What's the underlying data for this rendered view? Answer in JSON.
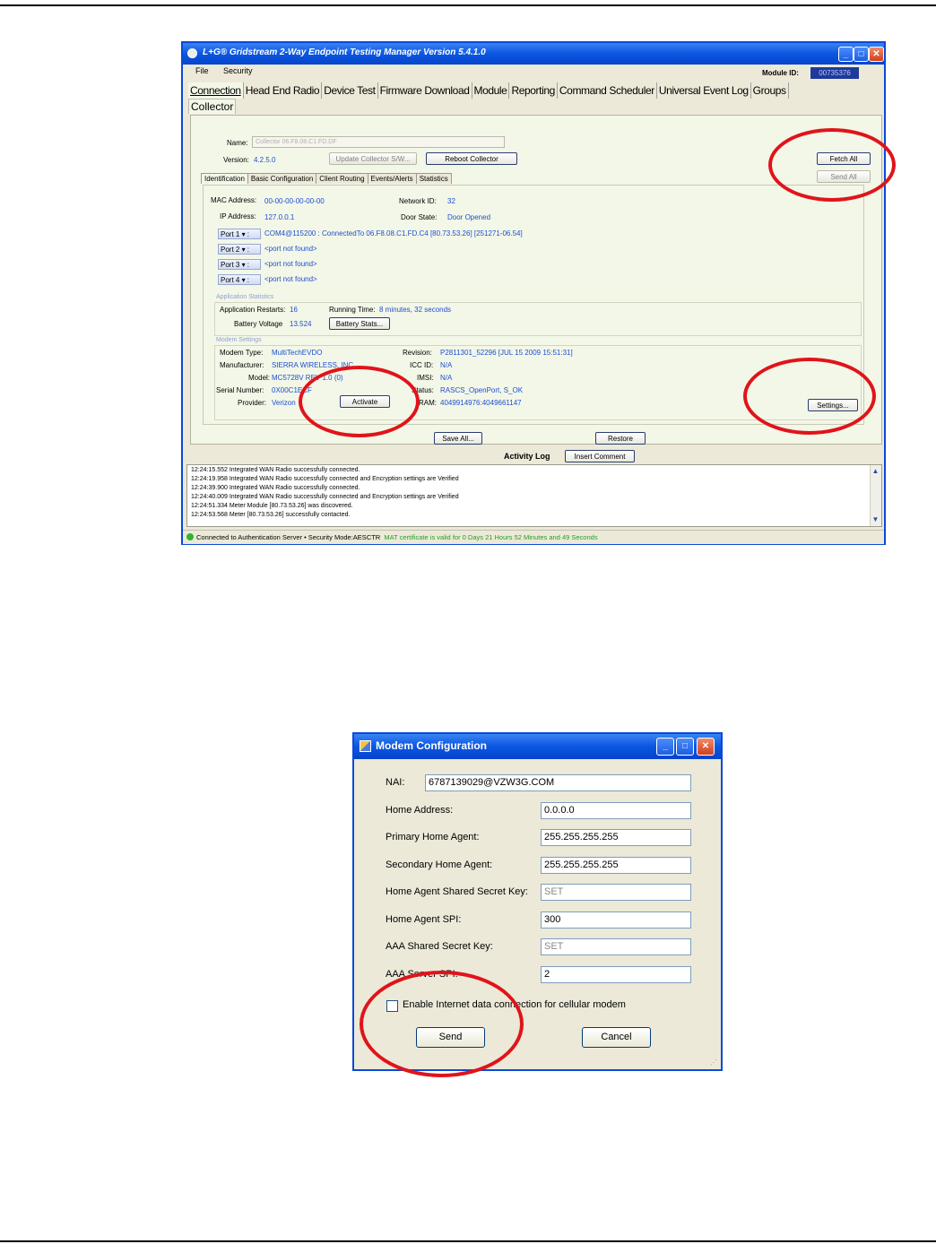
{
  "win1": {
    "title": "L+G® Gridstream 2-Way Endpoint Testing Manager Version 5.4.1.0",
    "menu": [
      "File",
      "Security"
    ],
    "module_id_label": "Module ID:",
    "module_id_value": "00735376",
    "tabs": [
      "Connection",
      "Head End Radio",
      "Device Test",
      "Firmware Download",
      "Module",
      "Reporting",
      "Command Scheduler",
      "Universal Event Log",
      "Groups"
    ],
    "active_tab": "Collector",
    "name_label": "Name:",
    "name_value": "Collector 06.F8.08.C1.FD.DF",
    "version_label": "Version:",
    "version_value": "4.2.5.0",
    "update_btn": "Update Collector S/W...",
    "reboot_btn": "Reboot Collector",
    "fetch_all_btn": "Fetch All",
    "send_all_btn": "Send All",
    "subtabs": [
      "Identification",
      "Basic Configuration",
      "Client Routing",
      "Events/Alerts",
      "Statistics"
    ],
    "mac_label": "MAC Address:",
    "mac_value": "00-00-00-00-00-00",
    "ip_label": "IP Address:",
    "ip_value": "127.0.0.1",
    "netid_label": "Network ID:",
    "netid_value": "32",
    "door_label": "Door State:",
    "door_value": "Door Opened",
    "ports": [
      {
        "label": "Port 1",
        "value": "COM4@115200 : ConnectedTo 06.F8.08.C1.FD.C4 [80.73.53.26]  [251271-06.54]"
      },
      {
        "label": "Port 2",
        "value": "<port not found>"
      },
      {
        "label": "Port 3",
        "value": "<port not found>"
      },
      {
        "label": "Port 4",
        "value": "<port not found>"
      }
    ],
    "app_stats_title": "Application Statistics",
    "restarts_label": "Application Restarts:",
    "restarts_value": "16",
    "running_label": "Running Time:",
    "running_value": "8 minutes, 32 seconds",
    "battery_label": "Battery Voltage",
    "battery_value": "13.524",
    "battery_btn": "Battery Stats...",
    "modem_title": "Modem Settings",
    "modem_type_label": "Modem Type:",
    "modem_type_value": "MultiTechEVDO",
    "manufacturer_label": "Manufacturer:",
    "manufacturer_value": "SIERRA WIRELESS, INC",
    "model_label": "Model:",
    "model_value": "MC5728V REV 1.0 (0)",
    "serial_label": "Serial Number:",
    "serial_value": "0X00C1ECF",
    "provider_label": "Provider:",
    "provider_value": "Verizon",
    "activate_btn": "Activate",
    "revision_label": "Revision:",
    "revision_value": "P2811301_52296 [JUL 15 2009 15:51:31]",
    "iccid_label": "ICC ID:",
    "iccid_value": "N/A",
    "imsi_label": "IMSI:",
    "imsi_value": "N/A",
    "status_label": "Status:",
    "status_value": "RASCS_OpenPort, S_OK",
    "ram_label": "RAM:",
    "ram_value": "4049914976:4049661147",
    "settings_btn": "Settings...",
    "save_all_btn": "Save All...",
    "restore_btn": "Restore",
    "activity_log_label": "Activity Log",
    "insert_comment_btn": "Insert Comment",
    "log_lines": [
      "12:24:15.552 Integrated WAN Radio successfully connected.",
      "12:24:19.958 Integrated WAN Radio successfully connected and Encryption settings are Verified",
      "12:24:39.900 Integrated WAN Radio successfully connected.",
      "12:24:40.009 Integrated WAN Radio successfully connected and Encryption settings are Verified",
      "12:24:51.334 Meter Module [80.73.53.26] was discovered.",
      "12:24:53.568 Meter [80.73.53.26] successfully contacted."
    ],
    "status_bar_text": "Connected to Authentication Server  •  Security Mode:AESCTR",
    "status_bar_green": "MAT certificate is valid for 0 Days 21 Hours 52 Minutes and 49 Seconds"
  },
  "win2": {
    "title": "Modem Configuration",
    "fields": [
      {
        "label": "NAI:",
        "value": "6787139029@VZW3G.COM"
      },
      {
        "label": "Home Address:",
        "value": "0.0.0.0"
      },
      {
        "label": "Primary Home Agent:",
        "value": "255.255.255.255"
      },
      {
        "label": "Secondary Home Agent:",
        "value": "255.255.255.255"
      },
      {
        "label": "Home Agent Shared Secret Key:",
        "value": "SET"
      },
      {
        "label": "Home Agent SPI:",
        "value": "300"
      },
      {
        "label": "AAA Shared Secret Key:",
        "value": "SET"
      },
      {
        "label": "AAA Server SPI:",
        "value": "2"
      }
    ],
    "checkbox_label": "Enable Internet  data connection for cellular modem",
    "send_btn": "Send",
    "cancel_btn": "Cancel"
  },
  "colors": {
    "highlight": "#e0141a",
    "value_text": "#1d4fd0",
    "titlebar": "#0b56e0"
  }
}
